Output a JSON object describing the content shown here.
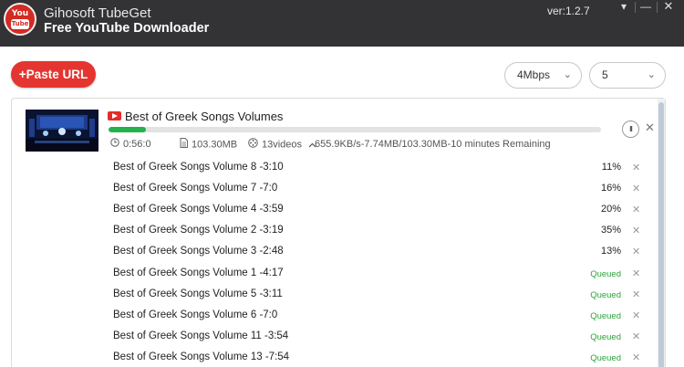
{
  "app": {
    "name": "Gihosoft TubeGet",
    "subtitle": "Free YouTube Downloader",
    "version": "ver:1.2.7",
    "logo_text_top": "You",
    "logo_text_bottom": "Tube"
  },
  "window_controls": {
    "menu": "▾",
    "minimize": "—",
    "close": "✕"
  },
  "toolbar": {
    "paste_url_label": "+Paste URL",
    "speed_limit": {
      "value": "4Mbps",
      "chevron": "⌄"
    },
    "concurrent": {
      "value": "5",
      "chevron": "⌄"
    }
  },
  "download": {
    "title": "Best of Greek Songs Volumes",
    "progress_fraction": 0.075,
    "duration": "0:56:0",
    "size": "103.30MB",
    "videos": "13videos",
    "speed_status": "655.9KB/s-7.74MB/103.30MB-10 minutes Remaining",
    "pause_label": "II",
    "remove_label": "✕",
    "items": [
      {
        "title": "Best of Greek Songs Volume 8 -3:10",
        "status": "11%",
        "queued": false
      },
      {
        "title": "Best of Greek Songs Volume 7 -7:0",
        "status": "16%",
        "queued": false
      },
      {
        "title": "Best of Greek Songs Volume 4 -3:59",
        "status": "20%",
        "queued": false
      },
      {
        "title": "Best of Greek Songs Volume 2 -3:19",
        "status": "35%",
        "queued": false
      },
      {
        "title": "Best of Greek Songs Volume 3 -2:48",
        "status": "13%",
        "queued": false
      },
      {
        "title": "Best of Greek Songs Volume 1 -4:17",
        "status": "Queued",
        "queued": true
      },
      {
        "title": "Best of Greek Songs Volume 5 -3:11",
        "status": "Queued",
        "queued": true
      },
      {
        "title": "Best of Greek Songs Volume 6 -7:0",
        "status": "Queued",
        "queued": true
      },
      {
        "title": "Best of Greek Songs Volume 11 -3:54",
        "status": "Queued",
        "queued": true
      },
      {
        "title": "Best of Greek Songs Volume 13 -7:54",
        "status": "Queued",
        "queued": true
      }
    ]
  },
  "colors": {
    "titlebar": "#333336",
    "accent_red": "#e53530",
    "progress_green": "#23b24b",
    "queued_green": "#2aa538"
  },
  "icons": {
    "clock": "clock-icon",
    "file": "file-icon",
    "film": "film-reel-icon",
    "collapse": "chevron-up-icon"
  }
}
